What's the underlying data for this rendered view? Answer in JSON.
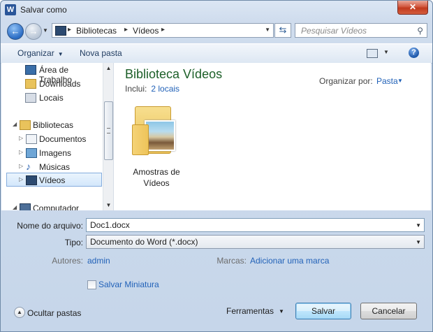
{
  "window": {
    "title": "Salvar como",
    "app_icon": "W"
  },
  "nav": {
    "breadcrumbs": [
      "Bibliotecas",
      "Vídeos"
    ],
    "search_placeholder": "Pesquisar Vídeos"
  },
  "toolbar": {
    "organize": "Organizar",
    "new_folder": "Nova pasta"
  },
  "sidebar": {
    "items": [
      {
        "label": "Área de Trabalho"
      },
      {
        "label": "Downloads"
      },
      {
        "label": "Locais"
      },
      {
        "label": "Bibliotecas"
      },
      {
        "label": "Documentos"
      },
      {
        "label": "Imagens"
      },
      {
        "label": "Músicas"
      },
      {
        "label": "Vídeos"
      },
      {
        "label": "Computador"
      }
    ]
  },
  "content": {
    "title": "Biblioteca Vídeos",
    "includes_label": "Inclui:",
    "includes_link": "2 locais",
    "arrange_label": "Organizar por:",
    "arrange_value": "Pasta",
    "folder_line1": "Amostras de",
    "folder_line2": "Vídeos"
  },
  "form": {
    "filename_label": "Nome do arquivo:",
    "filename_value": "Doc1.docx",
    "type_label": "Tipo:",
    "type_value": "Documento do Word (*.docx)",
    "authors_label": "Autores:",
    "authors_value": "admin",
    "tags_label": "Marcas:",
    "tags_value": "Adicionar uma marca",
    "thumbnail_label": "Salvar Miniatura"
  },
  "footer": {
    "hide_folders": "Ocultar pastas",
    "tools": "Ferramentas",
    "save": "Salvar",
    "cancel": "Cancelar"
  }
}
